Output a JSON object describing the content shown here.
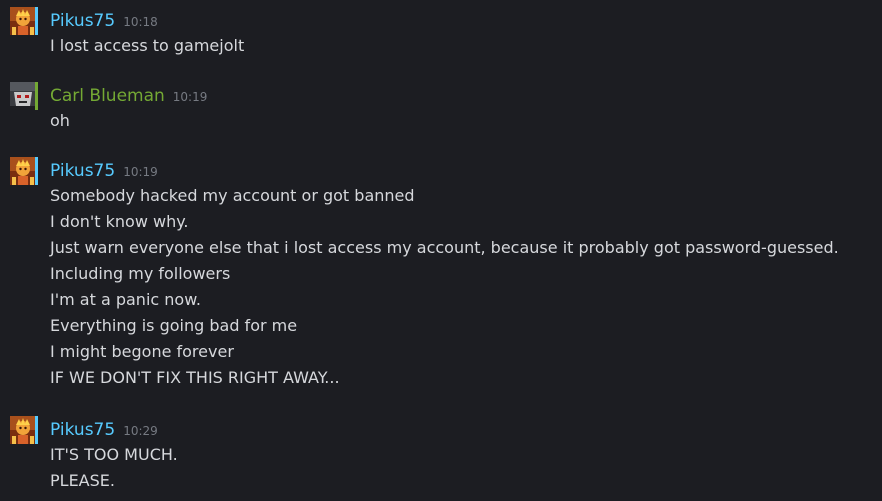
{
  "colors": {
    "background": "#1c1d22",
    "author_pikus": "#57cbff",
    "author_carl": "#74a934",
    "status_online": "#57cbff",
    "status_carl": "#74a934",
    "text": "#d6d8dc",
    "timestamp": "#767a82"
  },
  "messages": [
    {
      "author": "Pikus75",
      "time": "10:18",
      "avatar_icon": "pikus-avatar-icon",
      "lines": [
        "I lost access to gamejolt"
      ]
    },
    {
      "author": "Carl Blueman",
      "time": "10:19",
      "avatar_icon": "carl-avatar-icon",
      "lines": [
        "oh"
      ]
    },
    {
      "author": "Pikus75",
      "time": "10:19",
      "avatar_icon": "pikus-avatar-icon",
      "lines": [
        "Somebody hacked my account or got banned",
        "I don't know why.",
        "Just warn everyone else that i lost access my account, because it probably got password-guessed.",
        "Including my followers",
        "I'm at a panic now.",
        "Everything is going bad for me",
        "I might begone forever",
        "IF WE DON'T FIX THIS RIGHT AWAY..."
      ]
    },
    {
      "author": "Pikus75",
      "time": "10:29",
      "avatar_icon": "pikus-avatar-icon",
      "lines": [
        "IT'S TOO MUCH.",
        "PLEASE."
      ]
    }
  ]
}
